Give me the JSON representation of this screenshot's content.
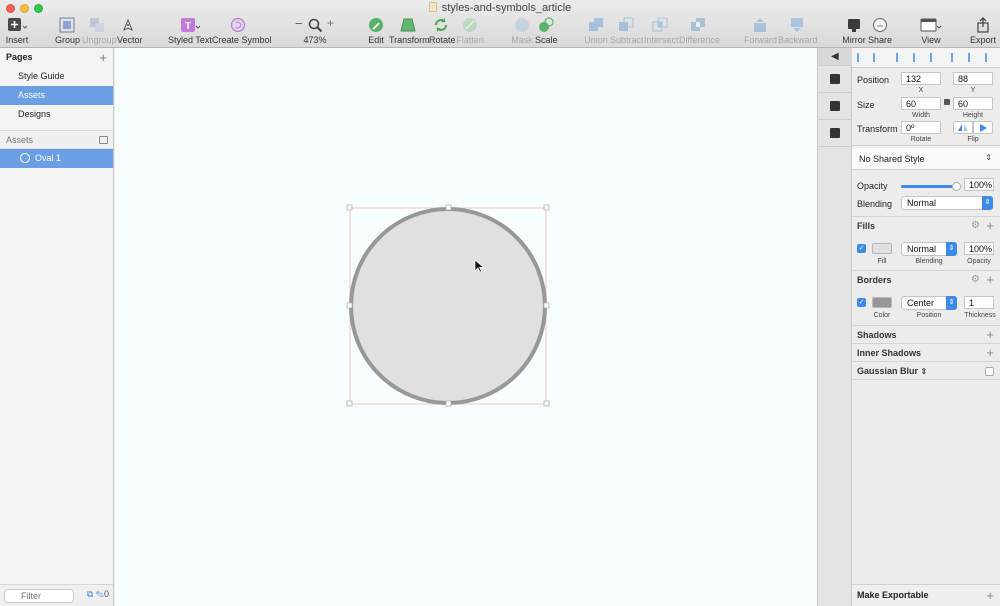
{
  "window": {
    "title": "styles-and-symbols_article"
  },
  "toolbar": {
    "insert": "Insert",
    "group": "Group",
    "ungroup": "Ungroup",
    "vector": "Vector",
    "styled_text": "Styled Text",
    "create_symbol": "Create Symbol",
    "zoom_minus": "−",
    "zoom_plus": "+",
    "zoom_level": "473%",
    "edit": "Edit",
    "transform": "Transform",
    "rotate": "Rotate",
    "flatten": "Flatten",
    "mask": "Mask",
    "scale": "Scale",
    "union": "Union",
    "subtract": "Subtract",
    "intersect": "Intersect",
    "difference": "Difference",
    "forward": "Forward",
    "backward": "Backward",
    "mirror": "Mirror",
    "share": "Share",
    "view": "View",
    "export": "Export"
  },
  "sidebar": {
    "pages_header": "Pages",
    "add_symbol": "+",
    "pages": [
      {
        "label": "Style Guide",
        "selected": false
      },
      {
        "label": "Assets",
        "selected": true
      },
      {
        "label": "Designs",
        "selected": false
      }
    ],
    "layers_header": "Assets",
    "layers": [
      {
        "label": "Oval 1",
        "selected": true
      }
    ],
    "filter_placeholder": "Filter",
    "filter_count": "0"
  },
  "inspector": {
    "position_label": "Position",
    "x": "132",
    "x_label": "X",
    "y": "88",
    "y_label": "Y",
    "size_label": "Size",
    "width": "60",
    "width_label": "Width",
    "height": "60",
    "height_label": "Height",
    "transform_label": "Transform",
    "rotate": "0º",
    "rotate_label": "Rotate",
    "flip_label": "Flip",
    "shared_style": "No Shared Style",
    "opacity_label": "Opacity",
    "opacity": "100%",
    "opacity_level": 1.0,
    "blending_label": "Blending",
    "blending": "Normal",
    "fills_header": "Fills",
    "fill_blending": "Normal",
    "fill_opacity": "100%",
    "fill_label": "Fill",
    "fill_blending_label": "Blending",
    "fill_opacity_label": "Opacity",
    "fill_color": "#e0e0e0",
    "borders_header": "Borders",
    "border_position": "Center",
    "border_thickness": "1",
    "border_color_label": "Color",
    "border_position_label": "Position",
    "border_thickness_label": "Thickness",
    "border_color": "#979797",
    "shadows_header": "Shadows",
    "inner_shadows_header": "Inner Shadows",
    "gaussian_blur_header": "Gaussian Blur",
    "make_exportable": "Make Exportable"
  },
  "canvas": {
    "background": "#f7fefd",
    "oval_fill": "#e0e0e0",
    "oval_stroke": "#979797",
    "selection_color": "#f2b6c0"
  }
}
